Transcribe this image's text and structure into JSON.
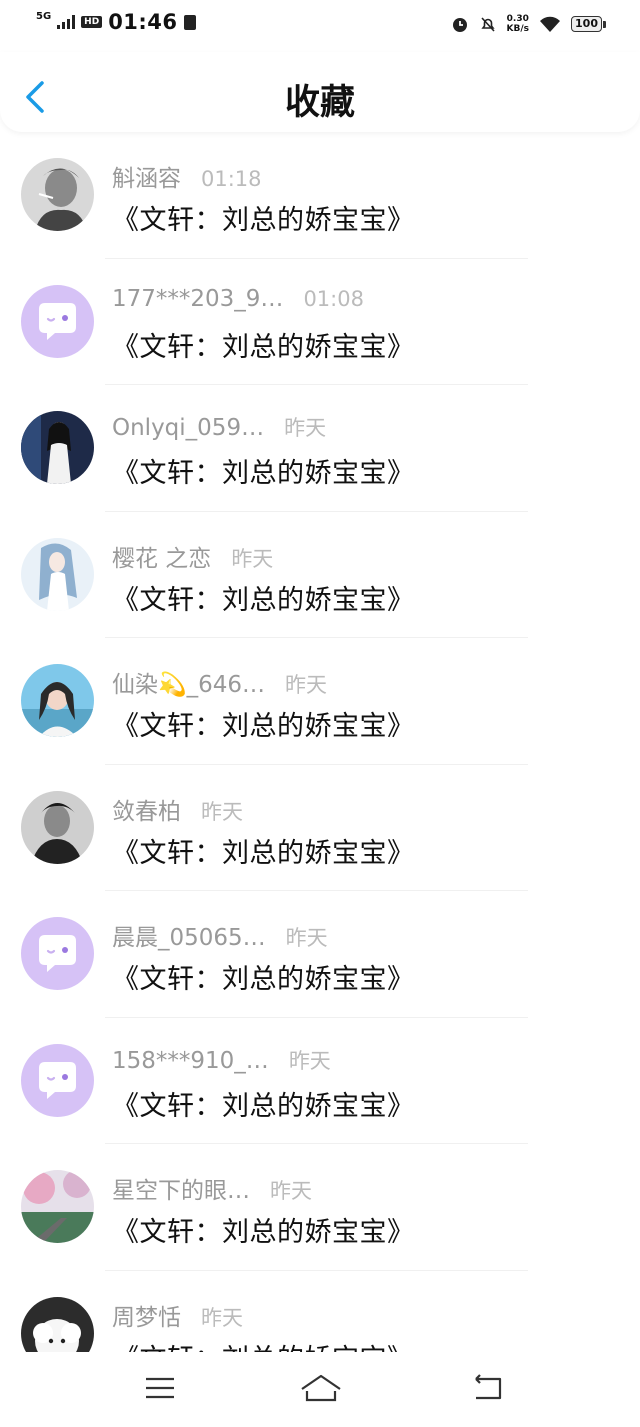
{
  "status_bar": {
    "network": "5G",
    "hd": "HD",
    "time": "01:46",
    "speed_value": "0.30",
    "speed_unit": "KB/s",
    "battery": "100"
  },
  "header": {
    "title": "收藏"
  },
  "items": [
    {
      "name": "斛涵容",
      "time": "01:18",
      "message": "《文轩：刘总的娇宝宝》",
      "avatar": "photo-man-smoking"
    },
    {
      "name": "177***203_9…",
      "time": "01:08",
      "message": "《文轩：刘总的娇宝宝》",
      "avatar": "default-chat"
    },
    {
      "name": "Onlyqi_059…",
      "time": "昨天",
      "message": "《文轩：刘总的娇宝宝》",
      "avatar": "photo-girl-dark"
    },
    {
      "name": "樱花 之恋",
      "time": "昨天",
      "message": "《文轩：刘总的娇宝宝》",
      "avatar": "photo-anime"
    },
    {
      "name": "仙染💫_646…",
      "time": "昨天",
      "message": "《文轩：刘总的娇宝宝》",
      "avatar": "photo-girl-sky"
    },
    {
      "name": "敛春柏",
      "time": "昨天",
      "message": "《文轩：刘总的娇宝宝》",
      "avatar": "photo-man-bw"
    },
    {
      "name": "晨晨_05065…",
      "time": "昨天",
      "message": "《文轩：刘总的娇宝宝》",
      "avatar": "default-chat"
    },
    {
      "name": "158***910_…",
      "time": "昨天",
      "message": "《文轩：刘总的娇宝宝》",
      "avatar": "default-chat"
    },
    {
      "name": "星空下的眼…",
      "time": "昨天",
      "message": "《文轩：刘总的娇宝宝》",
      "avatar": "photo-landscape"
    },
    {
      "name": "周梦恬",
      "time": "昨天",
      "message": "《文轩：刘总的娇宝宝》",
      "avatar": "photo-sheep"
    }
  ],
  "nav": {
    "menu_icon": "menu-icon",
    "home_icon": "home-icon",
    "back_icon": "return-icon"
  },
  "colors": {
    "accent": "#1a9be6",
    "default_avatar_bg": "#d6c2f6",
    "name_text": "#999999",
    "time_text": "#bbbbbb"
  }
}
